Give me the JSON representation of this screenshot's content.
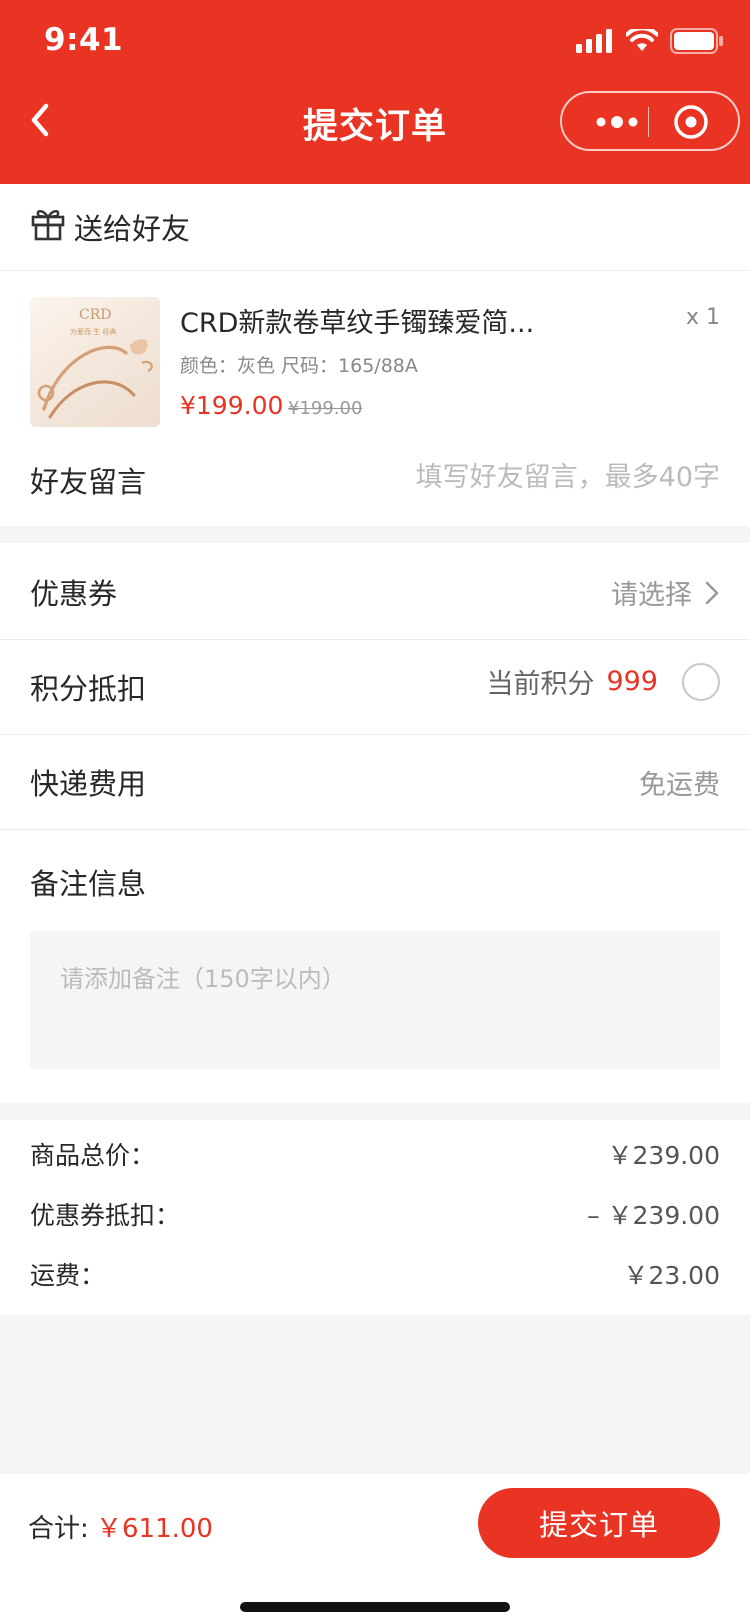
{
  "status_bar": {
    "time": "9:41"
  },
  "nav": {
    "title": "提交订单"
  },
  "gift": {
    "label": "送给好友"
  },
  "product": {
    "image_brand": "CRD",
    "image_tagline": "为爱而 生 经典",
    "name": "CRD新款卷草纹手镯臻爱简...",
    "quantity": "x 1",
    "spec": "颜色：灰色  尺码：165/88A",
    "price": "¥199.00",
    "original_price": "¥199.00"
  },
  "friend_message": {
    "label": "好友留言",
    "placeholder": "填写好友留言，最多40字"
  },
  "coupon": {
    "label": "优惠券",
    "value": "请选择"
  },
  "points": {
    "label": "积分抵扣",
    "text": "当前积分",
    "value": "999"
  },
  "shipping": {
    "label": "快递费用",
    "value": "免运费"
  },
  "remark": {
    "label": "备注信息",
    "placeholder": "请添加备注（150字以内）"
  },
  "summary": [
    {
      "label": "商品总价：",
      "value": "￥239.00"
    },
    {
      "label": "优惠券抵扣：",
      "value": "– ￥239.00"
    },
    {
      "label": "运费：",
      "value": "￥23.00"
    }
  ],
  "footer": {
    "total_label": "合计:",
    "total_value": "￥611.00",
    "submit_label": "提交订单"
  },
  "colors": {
    "accent": "#e93323",
    "background": "#f5f5f5",
    "text": "#282828",
    "muted": "#999999"
  }
}
